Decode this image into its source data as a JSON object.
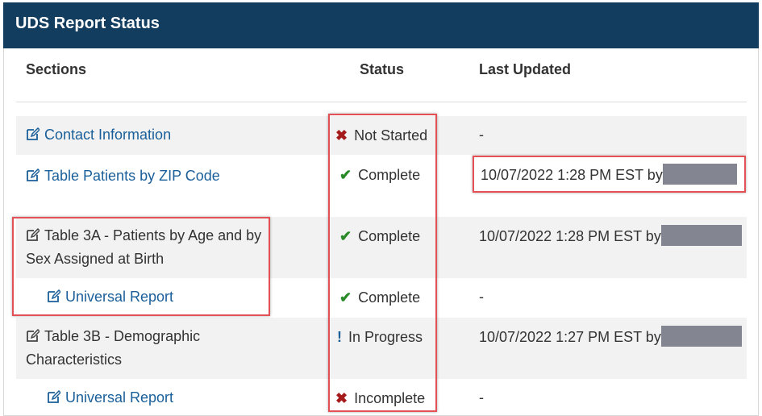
{
  "title": "UDS Report Status",
  "columns": {
    "sections": "Sections",
    "status": "Status",
    "updated": "Last Updated"
  },
  "rows": [
    {
      "section_plain": "",
      "section_link": "Contact Information",
      "status": "Not Started",
      "status_icon": "x",
      "updated": "-"
    },
    {
      "section_plain": "",
      "section_link": "Table Patients by ZIP Code",
      "status": "Complete",
      "status_icon": "check",
      "updated": "10/07/2022 1:28 PM EST by"
    },
    {
      "section_line1": "Table 3A - Patients by Age and by",
      "section_line2": "Sex Assigned at Birth",
      "status": "Complete",
      "status_icon": "check",
      "updated": "10/07/2022 1:28 PM EST by"
    },
    {
      "section_link": "Universal Report",
      "status": "Complete",
      "status_icon": "check",
      "updated": "-"
    },
    {
      "section_line1": "Table 3B - Demographic",
      "section_line2": "Characteristics",
      "status": "In Progress",
      "status_icon": "bang",
      "updated": "10/07/2022 1:27 PM EST by"
    },
    {
      "section_link": "Universal Report",
      "status": "Incomplete",
      "status_icon": "x",
      "updated": "-"
    }
  ],
  "icons": {
    "edit": "edit-icon",
    "x": "x-icon",
    "check": "check-icon",
    "bang": "exclamation-icon"
  },
  "colors": {
    "header_bg": "#123d5f",
    "link": "#1a5f99",
    "highlight": "#e35156",
    "check": "#2a8a28",
    "x": "#a51a1a"
  }
}
